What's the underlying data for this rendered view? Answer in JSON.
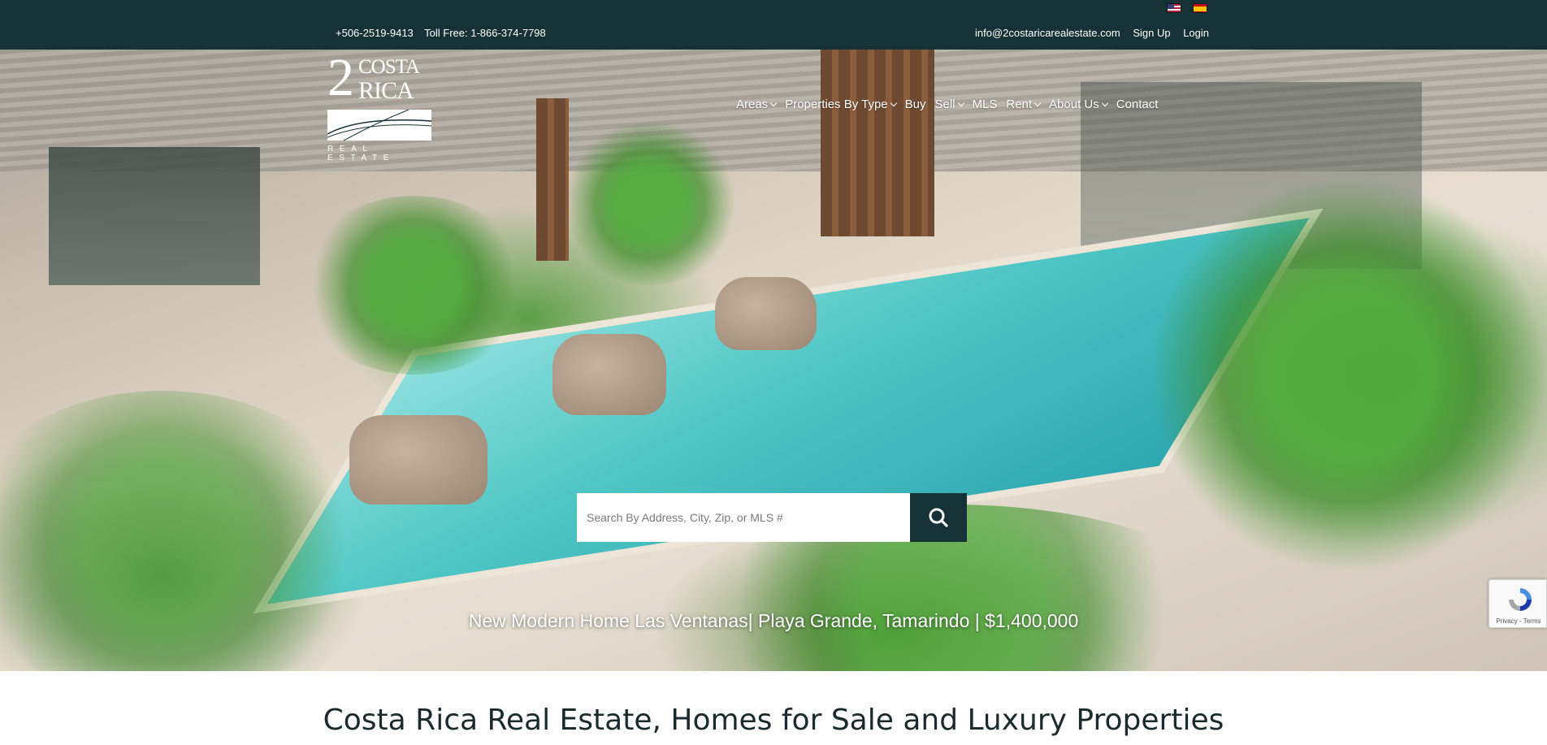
{
  "topbar": {
    "phone": "+506-2519-9413",
    "toll_free": "Toll Free: 1-866-374-7798",
    "email": "info@2costaricarealestate.com",
    "signup": "Sign Up",
    "login": "Login",
    "flags": [
      "us-flag-icon",
      "es-flag-icon"
    ]
  },
  "logo": {
    "number": "2",
    "word1": "COSTA",
    "word2": "RICA",
    "tagline": "REAL ESTATE"
  },
  "nav": {
    "items": [
      {
        "label": "Areas",
        "dropdown": true
      },
      {
        "label": "Properties By Type",
        "dropdown": true
      },
      {
        "label": "Buy",
        "dropdown": false
      },
      {
        "label": "Sell",
        "dropdown": true
      },
      {
        "label": "MLS",
        "dropdown": false
      },
      {
        "label": "Rent",
        "dropdown": true
      },
      {
        "label": "About Us",
        "dropdown": true
      },
      {
        "label": "Contact",
        "dropdown": false
      }
    ]
  },
  "search": {
    "placeholder": "Search By Address, City, Zip, or MLS #",
    "value": "",
    "button_icon": "search-icon"
  },
  "hero": {
    "caption": "New Modern Home Las Ventanas| Playa Grande, Tamarindo | $1,400,000"
  },
  "recaptcha": {
    "text": "Privacy - Terms"
  },
  "main": {
    "headline": "Costa Rica Real Estate, Homes for Sale and Luxury Properties"
  },
  "colors": {
    "topbar": "#173236",
    "search_button": "#173236",
    "nav_text": "#ffffff"
  }
}
